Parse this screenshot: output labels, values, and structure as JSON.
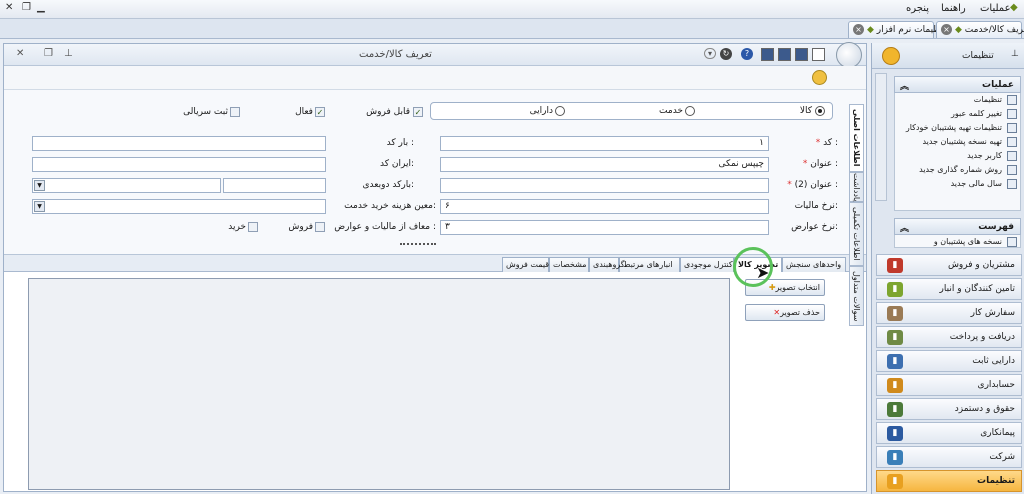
{
  "menubar": {
    "items": [
      "عملیات",
      "راهنما",
      "پنجره"
    ]
  },
  "doc_tabs": [
    {
      "label": "تنظیمات نرم افزار",
      "closable": true
    },
    {
      "label": "تعریف کالا/خدمت",
      "closable": true
    }
  ],
  "form": {
    "title": "تعریف کالا/خدمت",
    "type_options": [
      {
        "label": "کالا",
        "selected": true
      },
      {
        "label": "خدمت",
        "selected": false
      },
      {
        "label": "دارایی",
        "selected": false
      }
    ],
    "checkboxes": [
      {
        "label": "قابل فروش",
        "checked": true
      },
      {
        "label": "فعال",
        "checked": true
      },
      {
        "label": "ثبت سریالی",
        "checked": false
      }
    ],
    "fields": {
      "code_label": "کد :",
      "code_value": "۱",
      "barcode_label": "بار کد :",
      "title_label": "عنوان :",
      "title_value": "چیپس نمکی",
      "iran_code_label": "ایران کد:",
      "title2_label": "عنوان (2) :",
      "dual_barcode_label": "بارکد دوبعدی:",
      "tax_rate_label": "نرخ مالیات:",
      "tax_rate_value": "۶",
      "cost_label": "معین هزینه خرید خدمت:",
      "duty_rate_label": "نرخ عوارض:",
      "duty_rate_value": "۳",
      "exempt_label": "معاف از مالیات و عوارض :",
      "exempt_sale": "فروش",
      "exempt_purchase": "خرید"
    },
    "side_tabs": [
      "اطلاعات اصلی",
      "یادداشت",
      "اطلاعات تکمیلی",
      "سوالات متداول"
    ],
    "lower_tabs": [
      "واحدهای سنجش",
      "تصویر کالا",
      "کنترل موجودی",
      "انبارهای مرتبط",
      "گروهبندی",
      "مشخصات",
      "قیمت فروش"
    ],
    "active_lower_tab": "تصویر کالا",
    "buttons": {
      "choose_image": "انتخاب تصویر",
      "delete_image": "حذف تصویر"
    }
  },
  "right_panel": {
    "title": "تنظیمات",
    "operations_title": "عملیات",
    "operations": [
      "تنظیمات",
      "تغییر کلمه عبور",
      "تنظیمات تهیه پشتیبان خودکار",
      "تهیه نسخه پشتیبان جدید",
      "کاربر جدید",
      "روش شماره گذاری جدید",
      "سال مالی جدید"
    ],
    "list_title": "فهرست",
    "list_items": [
      "نسخه های پشتیبان و"
    ],
    "nav": [
      "مشتریان و فروش",
      "تامین کنندگان و انبار",
      "سفارش کار",
      "دریافت و پرداخت",
      "دارایی ثابت",
      "حسابداری",
      "حقوق و دستمزد",
      "پیمانکاری",
      "شرکت",
      "تنظیمات"
    ],
    "active_nav": "تنظیمات"
  }
}
